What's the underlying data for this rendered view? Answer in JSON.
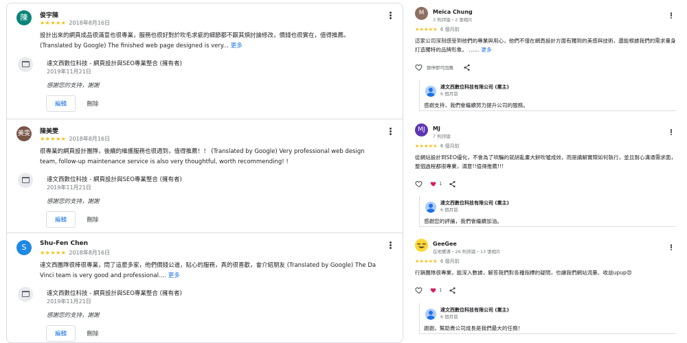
{
  "left_reviews": [
    {
      "avatar_letter": "陳",
      "avatar_color": "#0b8478",
      "name": "俊宇陳",
      "stars": "★★★★★",
      "date": "2018年8月16日",
      "text": "設計出來的網頁成品很滿意也很專業，服務也很好對於吹毛求疵的細節都不厭其煩討論修改，價錢也很實在，值得推薦。 (Translated by Google) The finished web page designed is very...",
      "more": "更多",
      "owner_name": "達文西數位科技 - 網頁設計與SEO專業整合 (擁有者)",
      "owner_date": "2019年11月21日",
      "owner_reply": "感謝您的支持，謝謝",
      "edit_label": "編輯",
      "delete_label": "刪除"
    },
    {
      "avatar_letter": "美雯",
      "avatar_color": "#795548",
      "name": "陳美雯",
      "stars": "★★★★★",
      "date": "2018年8月16日",
      "text": "很專業的網頁設計團隊，後續的維護服務也很週到，值得推薦！！ (Translated by Google) Very professional web design team, follow-up maintenance service is also very thoughtful, worth recommending! !",
      "more": "",
      "owner_name": "達文西數位科技 - 網頁設計與SEO專業整合 (擁有者)",
      "owner_date": "2019年11月21日",
      "owner_reply": "感謝您的支持，謝謝",
      "edit_label": "編輯",
      "delete_label": "刪除"
    },
    {
      "avatar_letter": "S",
      "avatar_color": "#1e88e5",
      "name": "Shu-Fen Chen",
      "stars": "★★★★★",
      "date": "2018年8月16日",
      "text": "達文西團隊很棒很專業，問了這麼多家，他們價錢公道，貼心的服務，真的很喜歡，會介紹朋友 (Translated by Google) The Da Vinci team is very good and professional....",
      "more": "更多",
      "owner_name": "達文西數位科技 - 網頁設計與SEO專業整合 (擁有者)",
      "owner_date": "2019年11月21日",
      "owner_reply": "感謝您的支持，謝謝",
      "edit_label": "編輯",
      "delete_label": "刪除"
    }
  ],
  "right_reviews": [
    {
      "avatar_letter": "M",
      "avatar_color": "#8d6e63",
      "name": "Meica Chung",
      "meta": "3 則評論・2 張相片",
      "stars": "★★★★★",
      "date": "6 個月前",
      "text": "這家公司深刻感受到他們的專業與用心，他們不僅在網頁設計方面有獨到的美感與技術，還能根據我們的需求量身打造獨特的品牌形象。 ……",
      "more": "更多",
      "like_label": "替停即可回應",
      "like_count": "",
      "owner_name": "達文西數位科技有限公司 (業主)",
      "owner_date": "6 個月前",
      "owner_reply": "感謝支持，我們會繼續努力提升公司的服務。"
    },
    {
      "avatar_letter": "MJ",
      "avatar_color": "#5e35b1",
      "name": "MJ",
      "meta": "7 則評論",
      "stars": "★★★★★",
      "date": "6 個月前",
      "text": "從網站設計到SEO優化，不會為了哄騙的就胡亂畫大餅吹噓成效，而是講解實際如何執行，並且耐心溝通需求面，整個過程都很專業，滿意!!值得推薦!!!",
      "more": "",
      "like_label": "",
      "like_count": "1",
      "owner_name": "達文西數位科技有限公司 (業主)",
      "owner_date": "6 個月前",
      "owner_reply": "感謝您的評論，我們會繼續加油。"
    },
    {
      "avatar_letter": "",
      "avatar_color": "#fdd835",
      "name": "GeeGee",
      "meta": "在地嚮導・26 則評論・13 張相片",
      "stars": "★★★★★",
      "date": "6 個月前",
      "text": "行銷團隊很專業，能深入數據，解答我們對各種指標的疑問，也讓我們網站流量、收益upup😍",
      "more": "",
      "like_label": "",
      "like_count": "1",
      "owner_name": "達文西數位科技有限公司 (業主)",
      "owner_date": "6 個月前",
      "owner_reply": "謝謝，幫助貴公司成長是我們最大的任務！"
    }
  ]
}
